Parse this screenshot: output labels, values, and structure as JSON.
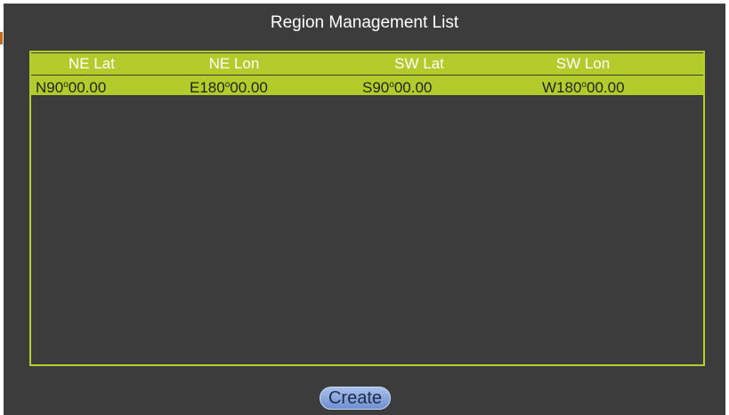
{
  "window": {
    "title": "Region Management List"
  },
  "table": {
    "columns": [
      "NE Lat",
      "NE Lon",
      "SW Lat",
      "SW Lon"
    ],
    "rows": [
      {
        "ne_lat": {
          "prefix": "N90",
          "degree": "o",
          "suffix": "00.00"
        },
        "ne_lon": {
          "prefix": "E180",
          "degree": "o",
          "suffix": "00.00"
        },
        "sw_lat": {
          "prefix": "S90",
          "degree": "o",
          "suffix": "00.00"
        },
        "sw_lon": {
          "prefix": "W180",
          "degree": "o",
          "suffix": "00.00"
        }
      }
    ]
  },
  "actions": {
    "create_label": "Create"
  },
  "colors": {
    "background": "#3c3c3c",
    "accent": "#b3cc2c",
    "button": "#8aa6df"
  }
}
